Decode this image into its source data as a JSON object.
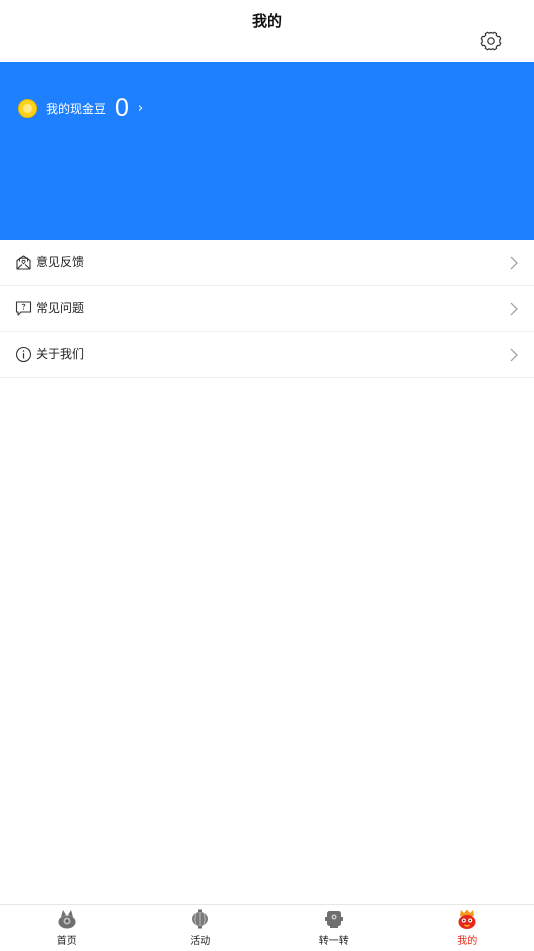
{
  "header": {
    "title": "我的",
    "settings_icon": "gear-icon"
  },
  "banner": {
    "background_color": "#1e80ff",
    "cash_label": "我的现金豆",
    "cash_value": "0",
    "chevron": "›",
    "coin_icon": "coin-icon"
  },
  "menu": {
    "items": [
      {
        "label": "意见反馈",
        "icon": "feedback-mail-icon"
      },
      {
        "label": "常见问题",
        "icon": "faq-bubble-icon"
      },
      {
        "label": "关于我们",
        "icon": "info-circle-icon"
      }
    ]
  },
  "tabbar": {
    "active_color": "#e8271a",
    "tabs": [
      {
        "label": "首页",
        "icon": "home-mascot-icon",
        "active": false
      },
      {
        "label": "活动",
        "icon": "lantern-icon",
        "active": false
      },
      {
        "label": "转一转",
        "icon": "robot-icon",
        "active": false
      },
      {
        "label": "我的",
        "icon": "profile-mascot-icon",
        "active": true
      }
    ]
  }
}
